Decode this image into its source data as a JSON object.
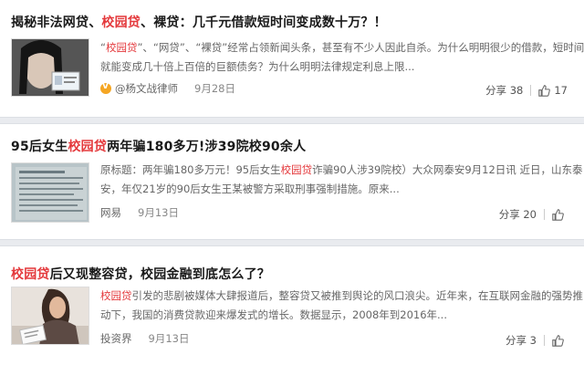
{
  "cards": [
    {
      "title_parts": [
        "揭秘非法网贷、",
        "校园贷",
        "、裸贷：几千元借款短时间变成数十万？！"
      ],
      "summary_line1_parts": [
        "“",
        "校园贷",
        "”、“网贷”、“裸贷”经常占领新闻头条，甚至有不少人因此自杀。为什么明明很少的借款，短时间内"
      ],
      "summary_line2": "就能变成几十倍上百倍的巨额债务？为什么明明法律规定利息上限...",
      "source": "@杨文战律师",
      "date": "9月28日",
      "share_label": "分享",
      "share_count": "38",
      "like_count": "17"
    },
    {
      "title_parts": [
        "95后女生",
        "校园贷",
        "两年骗180多万!涉39院校90余人"
      ],
      "summary_line1_parts": [
        "原标题：两年骗180多万元！95后女生",
        "校园贷",
        "诈骗90人涉39院校）大众网泰安9月12日讯 近日，山东泰"
      ],
      "summary_line2": "安，年仅21岁的90后女生王某被警方采取刑事强制措施。原来...",
      "source": "网易",
      "date": "9月13日",
      "share_label": "分享",
      "share_count": "20",
      "like_count": ""
    },
    {
      "title_parts": [
        "",
        "校园贷",
        "后又现整容贷，校园金融到底怎么了？"
      ],
      "summary_line1_parts": [
        "",
        "校园贷",
        "引发的悲剧被媒体大肆报道后，整容贷又被推到舆论的风口浪尖。近年来，在互联网金融的强势推"
      ],
      "summary_line2": "动下，我国的消费贷款迎来爆发式的增长。数据显示，2008年到2016年...",
      "source": "投资界",
      "date": "9月13日",
      "share_label": "分享",
      "share_count": "3",
      "like_count": ""
    }
  ],
  "colors": {
    "highlight": "#e4393c",
    "separator": "#e9ebef",
    "verified": "#f5a623"
  },
  "icons": {
    "verified": "verified-v-icon",
    "like": "thumbs-up-icon"
  }
}
